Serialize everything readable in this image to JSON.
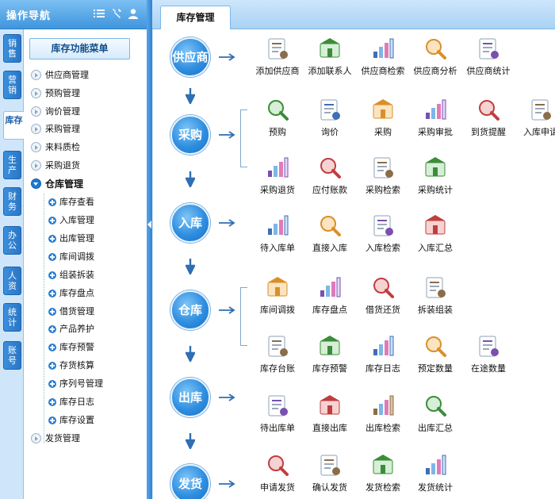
{
  "nav": {
    "title": "操作导航",
    "header_icons": [
      "list-icon",
      "wrench-icon",
      "user-icon"
    ]
  },
  "vertical_tabs": [
    {
      "label": "销售",
      "active": false
    },
    {
      "label": "营销",
      "active": false
    },
    {
      "label": "库存",
      "active": true
    },
    {
      "label": "生产",
      "active": false
    },
    {
      "label": "财务",
      "active": false
    },
    {
      "label": "办公",
      "active": false
    },
    {
      "label": "人资",
      "active": false
    },
    {
      "label": "统计",
      "active": false
    },
    {
      "label": "账号",
      "active": false
    }
  ],
  "menu": {
    "title": "库存功能菜单",
    "top_items": [
      "供应商管理",
      "预购管理",
      "询价管理",
      "采购管理",
      "来料质检",
      "采购退货"
    ],
    "open_item": "仓库管理",
    "sub_items": [
      "库存查看",
      "入库管理",
      "出库管理",
      "库间调拨",
      "组装拆装",
      "库存盘点",
      "借货管理",
      "产品养护",
      "库存预警",
      "存货核算",
      "序列号管理",
      "库存日志",
      "库存设置"
    ],
    "bottom_items": [
      "发货管理"
    ]
  },
  "tabs": [
    {
      "label": "库存管理",
      "active": true
    }
  ],
  "flow": {
    "stages": [
      {
        "label": "供应商",
        "rows": [
          [
            "添加供应商",
            "添加联系人",
            "供应商检索",
            "供应商分析",
            "供应商统计"
          ]
        ]
      },
      {
        "label": "采购",
        "rows": [
          [
            "预购",
            "询价",
            "采购",
            "采购审批",
            "到货提醒",
            "入库申请"
          ],
          [
            "采购退货",
            "应付账款",
            "采购检索",
            "采购统计"
          ]
        ]
      },
      {
        "label": "入库",
        "rows": [
          [
            "待入库单",
            "直接入库",
            "入库检索",
            "入库汇总"
          ]
        ]
      },
      {
        "label": "仓库",
        "rows": [
          [
            "库间调拨",
            "库存盘点",
            "借货还货",
            "拆装组装"
          ],
          [
            "库存台账",
            "库存预警",
            "库存日志",
            "预定数量",
            "在途数量"
          ]
        ]
      },
      {
        "label": "出库",
        "rows": [
          [
            "待出库单",
            "直接出库",
            "出库检索",
            "出库汇总"
          ]
        ]
      },
      {
        "label": "发货",
        "rows": [
          [
            "申请发货",
            "确认发货",
            "发货检索",
            "发货统计"
          ]
        ]
      }
    ]
  },
  "colors": {
    "accent": "#2f8ee0",
    "header": "#3f95dd",
    "tab_strip": "#a9d2f4"
  }
}
